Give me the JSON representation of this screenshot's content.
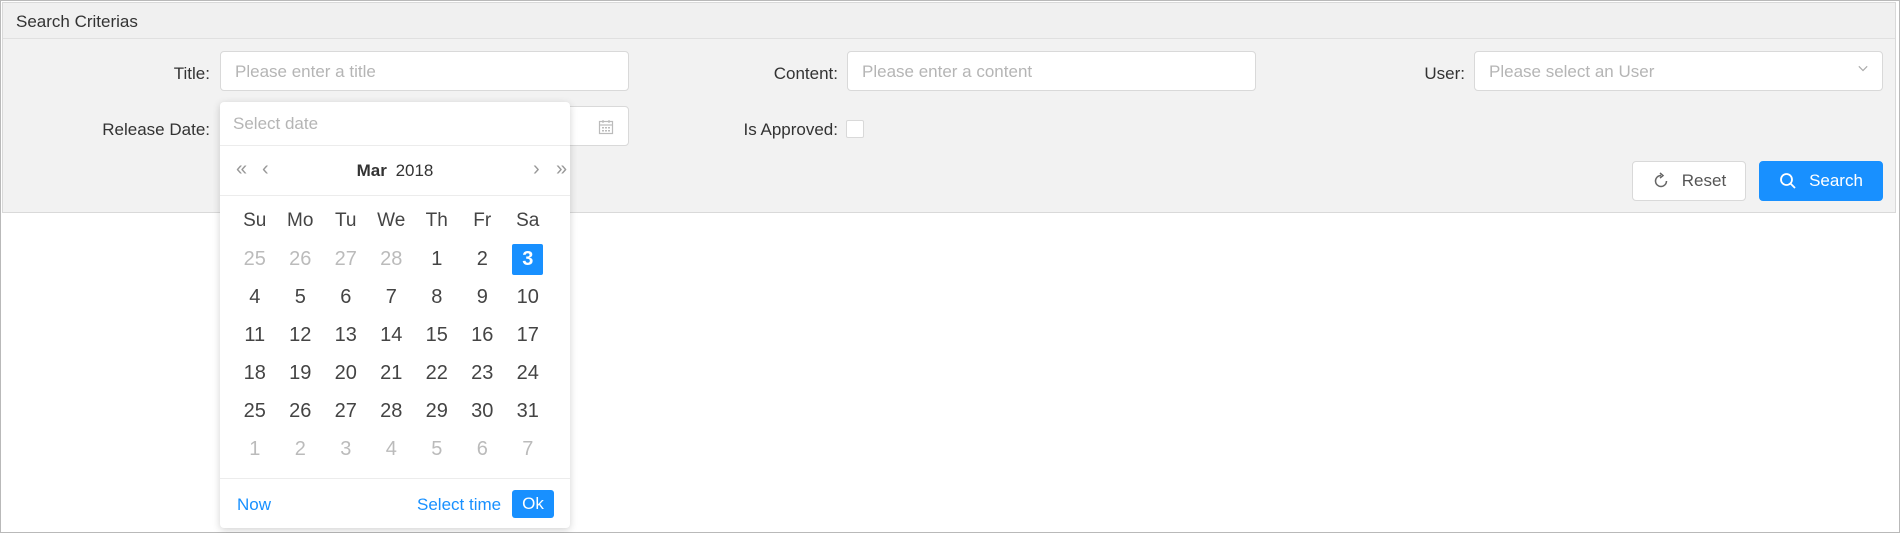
{
  "panel": {
    "title": "Search Criterias"
  },
  "fields": {
    "title": {
      "label": "Title:",
      "placeholder": "Please enter a title"
    },
    "content": {
      "label": "Content:",
      "placeholder": "Please enter a content"
    },
    "user": {
      "label": "User:",
      "placeholder": "Please select an User"
    },
    "release_date": {
      "label": "Release Date:"
    },
    "is_approved": {
      "label": "Is Approved:"
    }
  },
  "buttons": {
    "reset": "Reset",
    "search": "Search"
  },
  "datepicker": {
    "placeholder": "Select date",
    "month": "Mar",
    "year": "2018",
    "nav": {
      "prev_year": "«",
      "prev_month": "‹",
      "next_month": "›",
      "next_year": "»"
    },
    "weekdays": [
      "Su",
      "Mo",
      "Tu",
      "We",
      "Th",
      "Fr",
      "Sa"
    ],
    "weeks": [
      [
        "25",
        "26",
        "27",
        "28",
        "1",
        "2",
        "3"
      ],
      [
        "4",
        "5",
        "6",
        "7",
        "8",
        "9",
        "10"
      ],
      [
        "11",
        "12",
        "13",
        "14",
        "15",
        "16",
        "17"
      ],
      [
        "18",
        "19",
        "20",
        "21",
        "22",
        "23",
        "24"
      ],
      [
        "25",
        "26",
        "27",
        "28",
        "29",
        "30",
        "31"
      ],
      [
        "1",
        "2",
        "3",
        "4",
        "5",
        "6",
        "7"
      ]
    ],
    "selected_day": "3",
    "footer": {
      "now": "Now",
      "select_time": "Select time",
      "ok": "Ok"
    }
  },
  "colors": {
    "accent": "#1890ff"
  }
}
